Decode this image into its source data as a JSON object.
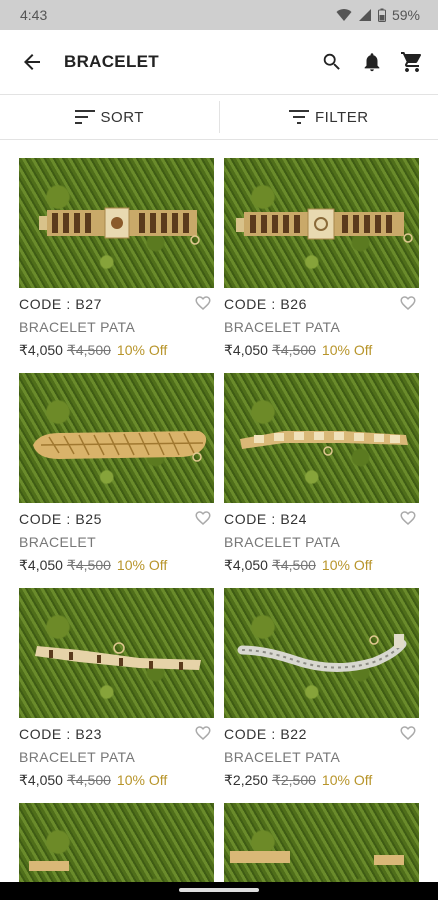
{
  "status_bar": {
    "time": "4:43",
    "battery": "59%"
  },
  "header": {
    "title": "BRACELET"
  },
  "toolbar": {
    "sort_label": "SORT",
    "filter_label": "FILTER"
  },
  "products": [
    {
      "code": "CODE : B27",
      "name": "BRACELET PATA",
      "price": "₹4,050",
      "mrp": "₹4,500",
      "discount": "10% Off"
    },
    {
      "code": "CODE : B26",
      "name": "BRACELET PATA",
      "price": "₹4,050",
      "mrp": "₹4,500",
      "discount": "10% Off"
    },
    {
      "code": "CODE : B25",
      "name": "BRACELET",
      "price": "₹4,050",
      "mrp": "₹4,500",
      "discount": "10% Off"
    },
    {
      "code": "CODE : B24",
      "name": "BRACELET PATA",
      "price": "₹4,050",
      "mrp": "₹4,500",
      "discount": "10% Off"
    },
    {
      "code": "CODE : B23",
      "name": "BRACELET PATA",
      "price": "₹4,050",
      "mrp": "₹4,500",
      "discount": "10% Off"
    },
    {
      "code": "CODE : B22",
      "name": "BRACELET PATA",
      "price": "₹2,250",
      "mrp": "₹2,500",
      "discount": "10% Off"
    }
  ],
  "icons": {
    "back": "arrow-left-icon",
    "search": "search-icon",
    "bell": "bell-icon",
    "cart": "cart-icon",
    "sort": "sort-icon",
    "filter": "filter-icon",
    "wishlist": "heart-outline-icon"
  },
  "colors": {
    "discount": "#b8952b",
    "status_bar": "#cfcfcf"
  }
}
